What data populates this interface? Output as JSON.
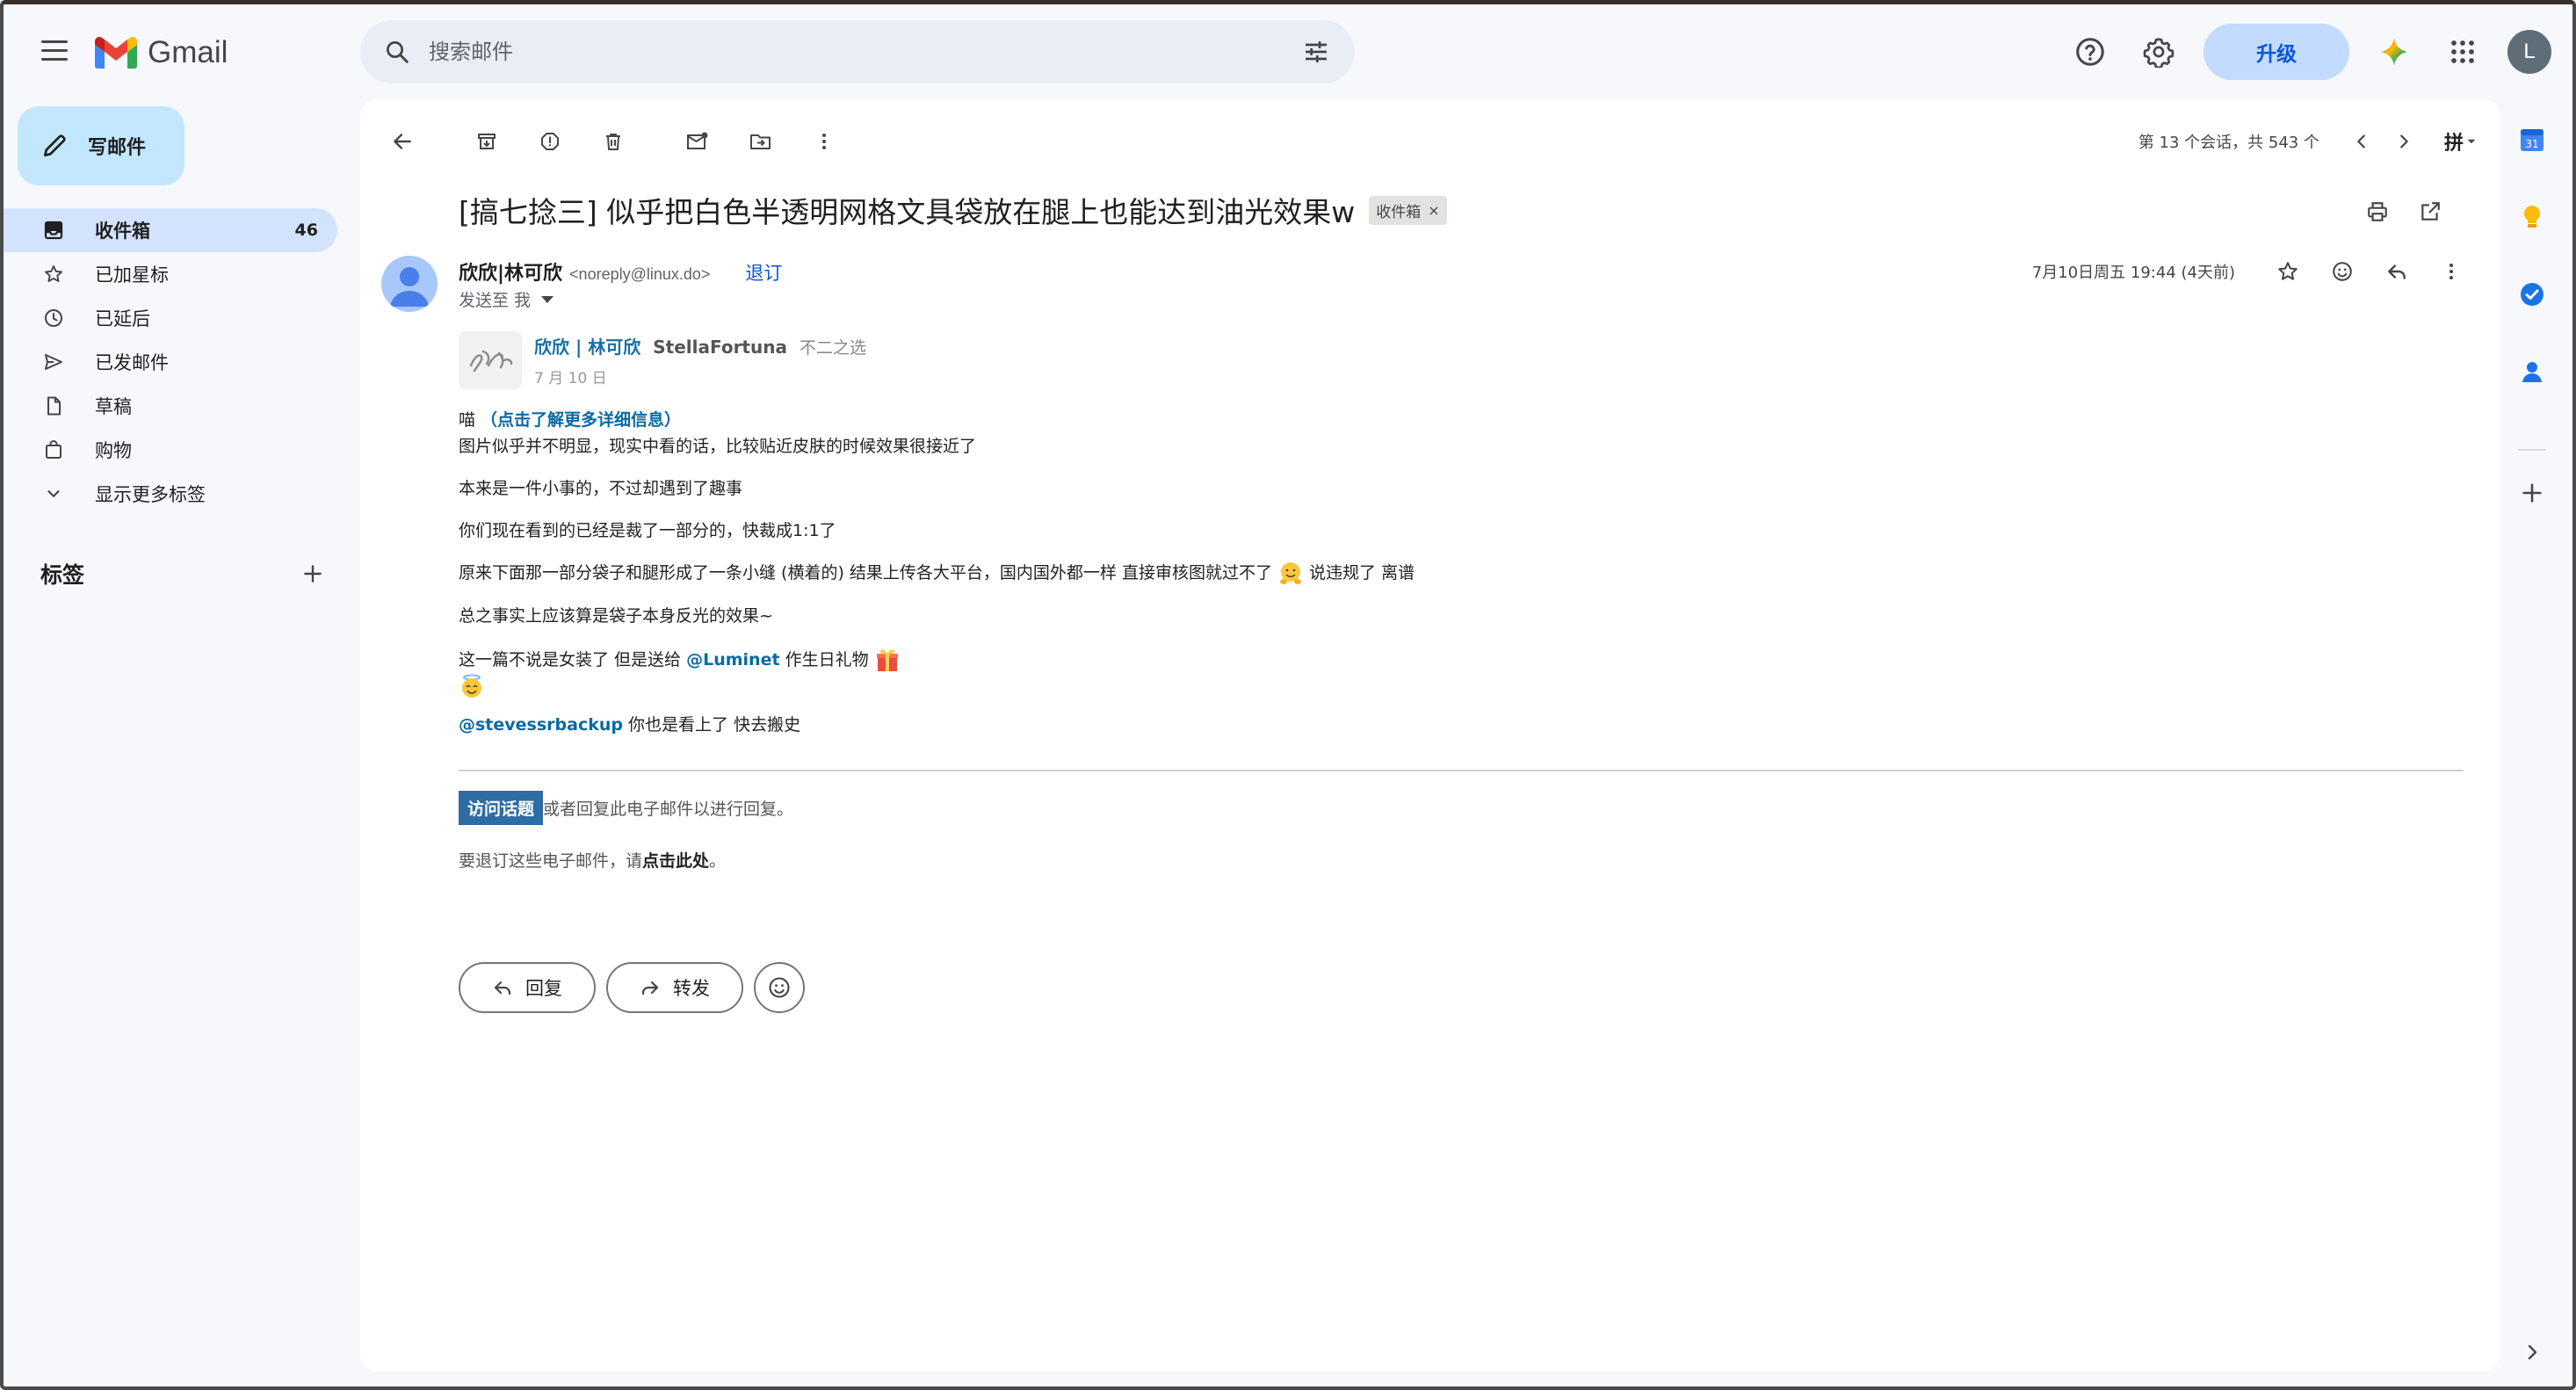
{
  "app": {
    "name": "Gmail"
  },
  "search": {
    "placeholder": "搜索邮件"
  },
  "header": {
    "upgrade_label": "升级",
    "account_initial": "L"
  },
  "sidebar": {
    "compose_label": "写邮件",
    "items": [
      {
        "label": "收件箱",
        "count": "46",
        "icon": "inbox-icon",
        "active": true
      },
      {
        "label": "已加星标",
        "count": "",
        "icon": "star-icon"
      },
      {
        "label": "已延后",
        "count": "",
        "icon": "clock-icon"
      },
      {
        "label": "已发邮件",
        "count": "",
        "icon": "send-icon"
      },
      {
        "label": "草稿",
        "count": "",
        "icon": "draft-icon"
      },
      {
        "label": "购物",
        "count": "",
        "icon": "shopping-icon"
      },
      {
        "label": "显示更多标签",
        "count": "",
        "icon": "chevron-down-icon"
      }
    ],
    "labels_heading": "标签"
  },
  "toolbar": {
    "pager_text": "第 13 个会话，共 543 个",
    "ime_label": "拼"
  },
  "message": {
    "subject": "[搞七捻三] 似乎把白色半透明网格文具袋放在腿上也能达到油光效果w",
    "label_chip": "收件箱",
    "label_chip_close": "×",
    "sender_name": "欣欣|林可欣",
    "sender_email": "<noreply@linux.do>",
    "unsubscribe_label": "退订",
    "to_text": "发送至 我",
    "date": "7月10日周五 19:44 (4天前)"
  },
  "post": {
    "author_name": "欣欣 | 林可欣",
    "author_user": "StellaFortuna",
    "author_title": "不二之选",
    "post_date": "7 月 10 日",
    "line1_prefix": "喵 ",
    "line1_link": "（点击了解更多详细信息）",
    "line2": "图片似乎并不明显，现实中看的话，比较贴近皮肤的时候效果很接近了",
    "line3": "本来是一件小事的，不过却遇到了趣事",
    "line4": "你们现在看到的已经是裁了一部分的，快裁成1:1了",
    "line5a": "原来下面那一部分袋子和腿形成了一条小缝 (横着的) 结果上传各大平台，国内国外都一样 直接审核图就过不了",
    "line5b": " 说违规了 离谱",
    "line6": "总之事实上应该算是袋子本身反光的效果~",
    "line7a": "这一篇不说是女装了 但是送给 ",
    "line7_mention": "@Luminet",
    "line7b": " 作生日礼物",
    "line8_mention": "@stevessrbackup",
    "line8b": " 你也是看上了 快去搬史"
  },
  "footer": {
    "visit_label": "访问话题",
    "visit_suffix": " 或者回复此电子邮件以进行回复。",
    "unsub_prefix": "要退订这些电子邮件，请",
    "unsub_link": "点击此处",
    "unsub_suffix": "。"
  },
  "actions": {
    "reply_label": "回复",
    "forward_label": "转发"
  },
  "side_panel": {
    "calendar_day": "31"
  },
  "colors": {
    "accent": "#0b57d0",
    "active_nav": "#d3e3fd",
    "compose_bg": "#c2e7ff",
    "link": "#0b6aa2",
    "visit_button": "#2d6da3"
  }
}
